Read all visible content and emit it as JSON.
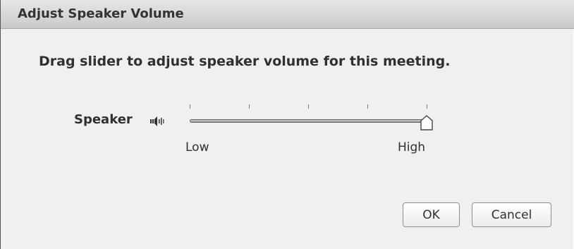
{
  "dialog": {
    "title": "Adjust Speaker Volume",
    "instruction": "Drag slider to adjust speaker volume for this meeting."
  },
  "speaker": {
    "label": "Speaker",
    "icon": "speaker-volume-icon",
    "volume_level_percent": 100,
    "tick_count": 5,
    "min_label": "Low",
    "max_label": "High"
  },
  "buttons": {
    "ok_label": "OK",
    "cancel_label": "Cancel"
  },
  "colors": {
    "dialog_background": "#f0f0f0",
    "titlebar_background": "#d7d7d7",
    "text": "#303030"
  }
}
